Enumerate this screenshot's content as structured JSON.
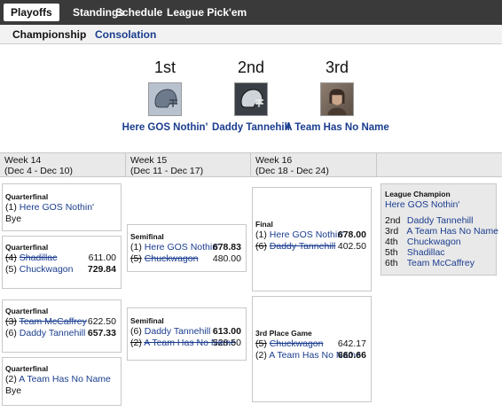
{
  "topnav": [
    {
      "label": "Playoffs",
      "active": true
    },
    {
      "label": "Standings",
      "active": false
    },
    {
      "label": "Schedule",
      "active": false
    },
    {
      "label": "League Pick'em",
      "active": false
    }
  ],
  "subnav": [
    {
      "label": "Championship",
      "active": true
    },
    {
      "label": "Consolation",
      "active": false
    }
  ],
  "podium": [
    {
      "place": "1st",
      "team": "Here GOS Nothin'"
    },
    {
      "place": "2nd",
      "team": "Daddy Tannehill"
    },
    {
      "place": "3rd",
      "team": "A Team Has No Name"
    }
  ],
  "weeks": [
    {
      "label": "Week 14",
      "dates": "(Dec 4 - Dec 10)"
    },
    {
      "label": "Week 15",
      "dates": "(Dec 11 - Dec 17)"
    },
    {
      "label": "Week 16",
      "dates": "(Dec 18 - Dec 24)"
    }
  ],
  "matchups": {
    "qf1": {
      "title": "Quarterfinal",
      "seed": "(1)",
      "team": "Here GOS Nothin'",
      "bye": "Bye"
    },
    "qf2": {
      "title": "Quarterfinal",
      "seed1": "(4)",
      "team1": "Shadillac",
      "score1": "611.00",
      "seed2": "(5)",
      "team2": "Chuckwagon",
      "score2": "729.84"
    },
    "qf3": {
      "title": "Quarterfinal",
      "seed1": "(3)",
      "team1": "Team McCaffrey",
      "score1": "622.50",
      "seed2": "(6)",
      "team2": "Daddy Tannehill",
      "score2": "657.33"
    },
    "qf4": {
      "title": "Quarterfinal",
      "seed": "(2)",
      "team": "A Team Has No Name",
      "bye": "Bye"
    },
    "sf1": {
      "title": "Semifinal",
      "seed1": "(1)",
      "team1": "Here GOS Nothin'",
      "score1": "678.83",
      "seed2": "(5)",
      "team2": "Chuckwagon",
      "score2": "480.00"
    },
    "sf2": {
      "title": "Semifinal",
      "seed1": "(6)",
      "team1": "Daddy Tannehill",
      "score1": "613.00",
      "seed2": "(2)",
      "team2": "A Team Has No Name",
      "score2": "528.50"
    },
    "final": {
      "title": "Final",
      "seed1": "(1)",
      "team1": "Here GOS Nothin'",
      "score1": "678.00",
      "seed2": "(6)",
      "team2": "Daddy Tannehill",
      "score2": "402.50"
    },
    "third": {
      "title": "3rd Place Game",
      "seed1": "(5)",
      "team1": "Chuckwagon",
      "score1": "642.17",
      "seed2": "(2)",
      "team2": "A Team Has No Name",
      "score2": "660.66"
    }
  },
  "champion": {
    "title": "League Champion",
    "team": "Here GOS Nothin'",
    "rest": [
      {
        "place": "2nd",
        "team": "Daddy Tannehill"
      },
      {
        "place": "3rd",
        "team": "A Team Has No Name"
      },
      {
        "place": "4th",
        "team": "Chuckwagon"
      },
      {
        "place": "5th",
        "team": "Shadillac"
      },
      {
        "place": "6th",
        "team": "Team McCaffrey"
      }
    ]
  },
  "colors": {
    "link": "#1a3d8f",
    "nav_bg": "#3a3a3a",
    "header_bg": "#e9e9e9"
  },
  "icons": [
    "helmet-icon",
    "team-photo-icon"
  ]
}
